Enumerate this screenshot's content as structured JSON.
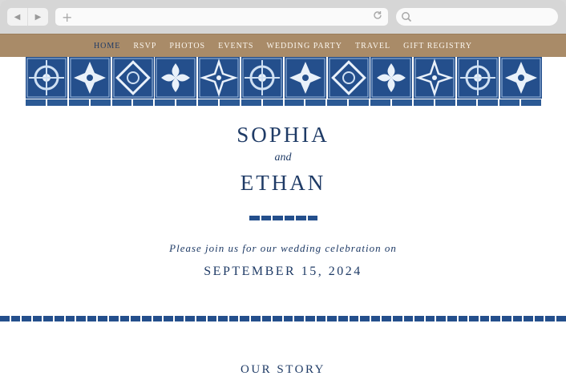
{
  "browser": {
    "back_icon": "back-arrow-icon",
    "forward_icon": "forward-arrow-icon",
    "new_tab_icon": "plus-icon",
    "reload_icon": "reload-icon",
    "search_icon": "search-icon"
  },
  "nav": {
    "items": [
      "HOME",
      "RSVP",
      "PHOTOS",
      "EVENTS",
      "WEDDING PARTY",
      "TRAVEL",
      "GIFT REGISTRY"
    ],
    "active": "HOME",
    "background": "#a98b68"
  },
  "hero": {
    "bride": "SOPHIA",
    "conjunction": "and",
    "groom": "ETHAN",
    "invitation": "Please join us for our wedding celebration on",
    "date": "SEPTEMBER 15, 2024"
  },
  "sections": {
    "story_title": "OUR STORY"
  },
  "colors": {
    "navy": "#1f3b66",
    "tile_blue": "#244f8c",
    "nav_tan": "#a98b68"
  }
}
